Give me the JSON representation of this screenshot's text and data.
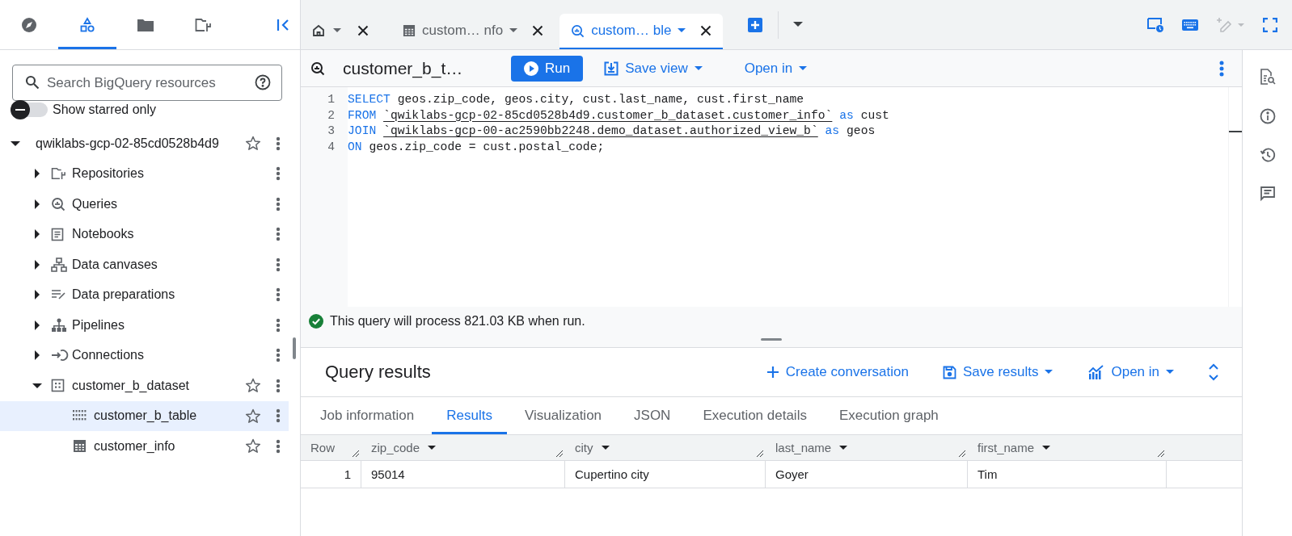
{
  "sidebar": {
    "nav_tabs": [
      {
        "kind": "explore",
        "selected": false
      },
      {
        "kind": "resources",
        "selected": true
      },
      {
        "kind": "files",
        "selected": false
      },
      {
        "kind": "repos",
        "selected": false
      }
    ],
    "search": {
      "placeholder": "Search BigQuery resources"
    },
    "starred_toggle": {
      "label": "Show starred only",
      "on": false
    },
    "tree": [
      {
        "label": "qwiklabs-gcp-02-85cd0528b4d9",
        "expanded": true,
        "starred": false,
        "selected": false,
        "children": [
          {
            "label": "Repositories",
            "kind": "repositories",
            "expanded": false,
            "selected": false
          },
          {
            "label": "Queries",
            "kind": "queries",
            "expanded": false,
            "selected": false
          },
          {
            "label": "Notebooks",
            "kind": "notebooks",
            "expanded": false,
            "selected": false
          },
          {
            "label": "Data canvases",
            "kind": "canvases",
            "expanded": false,
            "selected": false
          },
          {
            "label": "Data preparations",
            "kind": "preparations",
            "expanded": false,
            "selected": false
          },
          {
            "label": "Pipelines",
            "kind": "pipelines",
            "expanded": false,
            "selected": false
          },
          {
            "label": "Connections",
            "kind": "connections",
            "expanded": false,
            "selected": false
          },
          {
            "label": "customer_b_dataset",
            "kind": "dataset",
            "expanded": true,
            "starred": false,
            "selected": false,
            "children": [
              {
                "label": "customer_b_table",
                "kind": "view",
                "starred": false,
                "selected": true
              },
              {
                "label": "customer_info",
                "kind": "table",
                "starred": false,
                "selected": false
              }
            ]
          }
        ]
      }
    ]
  },
  "editor_tabs": [
    {
      "kind": "home",
      "selected": false
    },
    {
      "kind": "table",
      "label": "custom… nfo",
      "selected": false
    },
    {
      "kind": "query",
      "label": "custom… ble",
      "selected": true
    }
  ],
  "editor": {
    "title": "customer_b_t…",
    "buttons": [
      {
        "kind": "run",
        "label": "Run",
        "dropdown": false
      },
      {
        "kind": "save",
        "label": "Save view",
        "dropdown": true
      },
      {
        "kind": "open",
        "label": "Open in",
        "dropdown": true
      }
    ],
    "lines": [
      {
        "number": "1",
        "tokens": [
          {
            "kind": "keyword",
            "text": "SELECT"
          },
          {
            "kind": "plain",
            "text": " geos.zip_code, geos.city, cust.last_name, cust.first_name"
          }
        ]
      },
      {
        "number": "2",
        "tokens": [
          {
            "kind": "keyword",
            "text": "FROM "
          },
          {
            "kind": "identifier",
            "text": "`qwiklabs-gcp-02-85cd0528b4d9.customer_b_dataset.customer_info`"
          },
          {
            "kind": "keyword",
            "text": " as"
          },
          {
            "kind": "plain",
            "text": " cust"
          }
        ]
      },
      {
        "number": "3",
        "tokens": [
          {
            "kind": "keyword",
            "text": "JOIN "
          },
          {
            "kind": "identifier",
            "text": "`qwiklabs-gcp-00-ac2590bb2248.demo_dataset.authorized_view_b`"
          },
          {
            "kind": "keyword",
            "text": " as"
          },
          {
            "kind": "plain",
            "text": " geos"
          }
        ]
      },
      {
        "number": "4",
        "tokens": [
          {
            "kind": "keyword",
            "text": "ON"
          },
          {
            "kind": "plain",
            "text": " geos.zip_code = cust.postal_code;"
          }
        ]
      }
    ]
  },
  "status": {
    "kind": "success",
    "text": "This query will process 821.03 KB when run."
  },
  "results": {
    "title": "Query results",
    "actions": [
      {
        "kind": "conversation",
        "label": "Create conversation",
        "dropdown": false
      },
      {
        "kind": "save",
        "label": "Save results",
        "dropdown": true
      },
      {
        "kind": "chart",
        "label": "Open in",
        "dropdown": true
      }
    ],
    "tabs": [
      {
        "label": "Job information",
        "selected": false
      },
      {
        "label": "Results",
        "selected": true
      },
      {
        "label": "Visualization",
        "selected": false
      },
      {
        "label": "JSON",
        "selected": false
      },
      {
        "label": "Execution details",
        "selected": false
      },
      {
        "label": "Execution graph",
        "selected": false
      }
    ],
    "table": {
      "columns": [
        {
          "label": "Row",
          "menu": false
        },
        {
          "label": "zip_code",
          "menu": true
        },
        {
          "label": "city",
          "menu": true
        },
        {
          "label": "last_name",
          "menu": true
        },
        {
          "label": "first_name",
          "menu": true
        }
      ],
      "rows": [
        [
          "1",
          "95014",
          "Cupertino city",
          "Goyer",
          "Tim"
        ]
      ]
    }
  }
}
